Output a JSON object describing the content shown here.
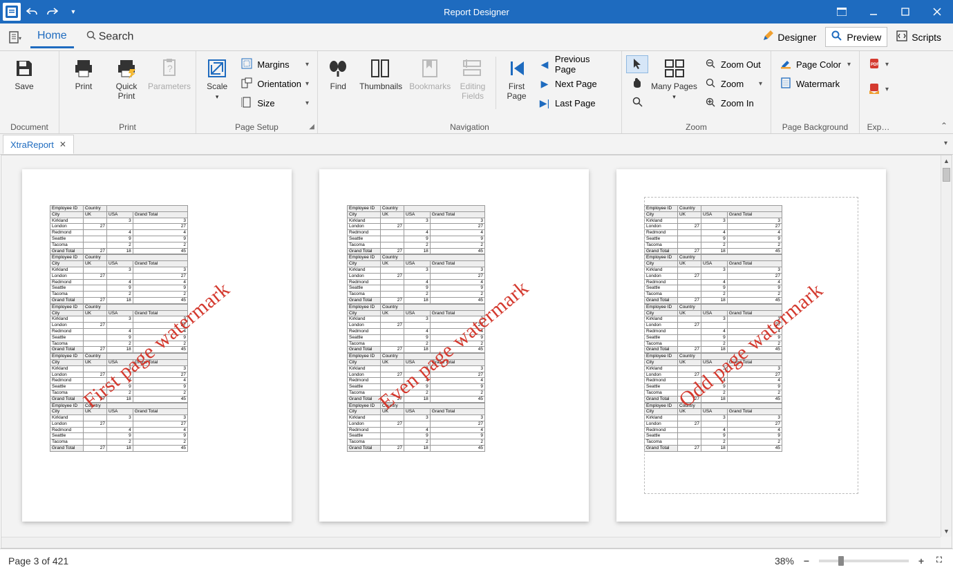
{
  "title": "Report Designer",
  "menu": {
    "home": "Home",
    "search": "Search"
  },
  "modes": {
    "designer": "Designer",
    "preview": "Preview",
    "scripts": "Scripts"
  },
  "ribbon": {
    "document": {
      "label": "Document",
      "save": "Save"
    },
    "print": {
      "label": "Print",
      "print": "Print",
      "quick": "Quick Print",
      "params": "Parameters"
    },
    "pagesetup": {
      "label": "Page Setup",
      "scale": "Scale",
      "margins": "Margins",
      "orientation": "Orientation",
      "size": "Size"
    },
    "nav": {
      "label": "Navigation",
      "find": "Find",
      "thumbs": "Thumbnails",
      "bookmarks": "Bookmarks",
      "editing": "Editing Fields",
      "first": "First Page",
      "prev": "Previous Page",
      "next": "Next  Page",
      "last": "Last  Page"
    },
    "zoom": {
      "label": "Zoom",
      "many": "Many Pages",
      "out": "Zoom Out",
      "zoom": "Zoom",
      "in": "Zoom In"
    },
    "bg": {
      "label": "Page Background",
      "color": "Page Color",
      "watermark": "Watermark"
    },
    "export": {
      "label": "Exp…"
    }
  },
  "doctab": "XtraReport",
  "watermarks": {
    "p1": "First page watermark",
    "p2": "Even page watermark",
    "p3": "Odd page watermark"
  },
  "table": {
    "emp": "Employee ID",
    "country": "Country",
    "city": "City",
    "uk": "UK",
    "usa": "USA",
    "gt": "Grand Total",
    "rows": [
      [
        "Kirkland",
        "",
        "3",
        "3"
      ],
      [
        "London",
        "27",
        "",
        "27"
      ],
      [
        "Redmond",
        "",
        "4",
        "4"
      ],
      [
        "Seattle",
        "",
        "9",
        "9"
      ],
      [
        "Tacoma",
        "",
        "2",
        "2"
      ],
      [
        "Grand Total",
        "27",
        "18",
        "45"
      ]
    ]
  },
  "status": {
    "page": "Page 3 of 421",
    "zoom": "38%"
  }
}
